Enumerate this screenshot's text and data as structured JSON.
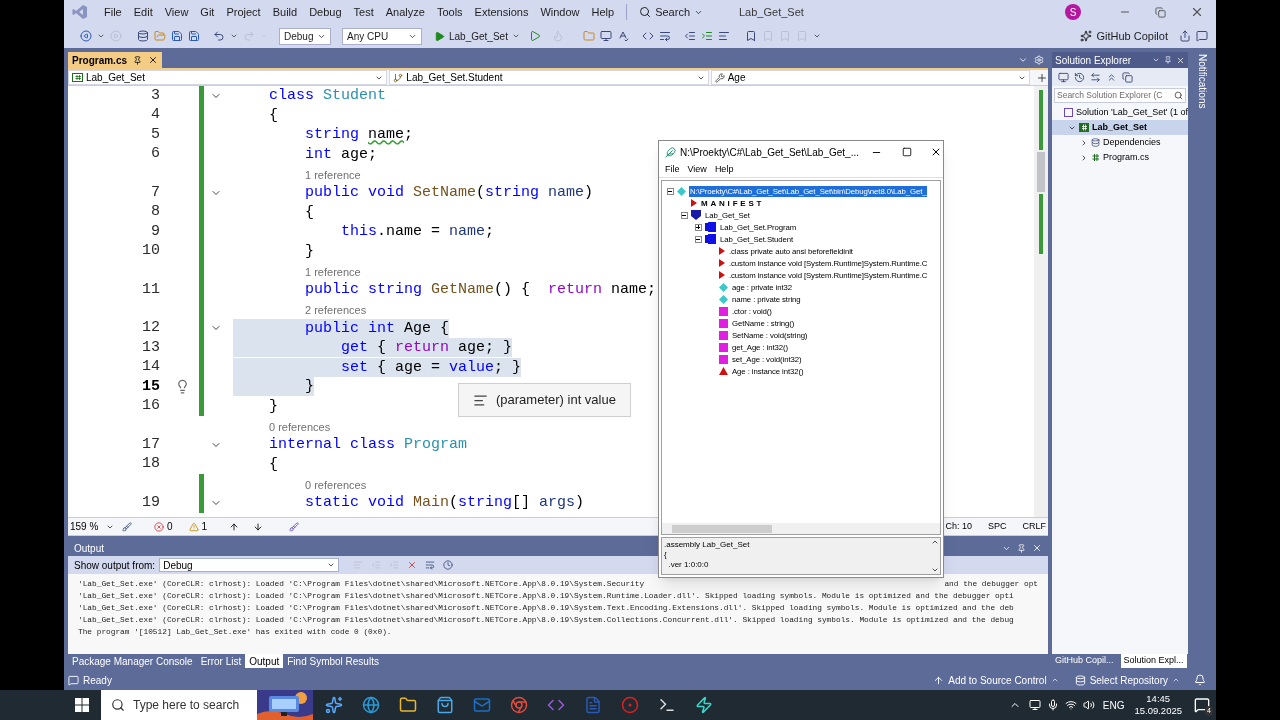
{
  "title_bar": {
    "menus": [
      "File",
      "Edit",
      "View",
      "Git",
      "Project",
      "Build",
      "Debug",
      "Test",
      "Analyze",
      "Tools",
      "Extensions",
      "Window",
      "Help"
    ],
    "search": "Search",
    "title": "Lab_Get_Set",
    "avatar": "S"
  },
  "toolbar": {
    "configuration": "Debug",
    "platform": "Any CPU",
    "start": "Lab_Get_Set",
    "copilot": "GitHub Copilot"
  },
  "editor": {
    "tabs": [
      {
        "label": "Program.cs",
        "selected": true
      }
    ],
    "navigation": [
      "Lab_Get_Set",
      "Lab_Get_Set.Student",
      "Age"
    ],
    "lines": [
      {
        "number": "3",
        "collapsible": true,
        "changed": true,
        "selected": false,
        "current": false,
        "tokens": [
          {
            "text": "    class ",
            "kind": "keyword"
          },
          {
            "text": "Student",
            "kind": "type"
          }
        ]
      },
      {
        "number": "4",
        "collapsible": false,
        "changed": true,
        "selected": false,
        "current": false,
        "tokens": [
          {
            "text": "    {",
            "kind": "plain"
          }
        ]
      },
      {
        "number": "5",
        "collapsible": false,
        "changed": true,
        "selected": false,
        "current": false,
        "tokens": [
          {
            "text": "        string ",
            "kind": "keyword"
          },
          {
            "text": "name",
            "kind": "plain",
            "squiggle": true
          },
          {
            "text": ";",
            "kind": "plain"
          }
        ]
      },
      {
        "number": "6",
        "collapsible": false,
        "changed": true,
        "selected": false,
        "current": false,
        "tokens": [
          {
            "text": "        int ",
            "kind": "keyword"
          },
          {
            "text": "age;",
            "kind": "plain"
          }
        ]
      },
      {
        "number": "7",
        "lens": "1 reference",
        "collapsible": true,
        "changed": true,
        "selected": false,
        "current": false,
        "tokens": [
          {
            "text": "        public void ",
            "kind": "keyword"
          },
          {
            "text": "SetName",
            "kind": "method"
          },
          {
            "text": "(",
            "kind": "plain"
          },
          {
            "text": "string ",
            "kind": "keyword"
          },
          {
            "text": "name",
            "kind": "param"
          },
          {
            "text": ")",
            "kind": "plain"
          }
        ]
      },
      {
        "number": "8",
        "collapsible": false,
        "changed": true,
        "selected": false,
        "current": false,
        "tokens": [
          {
            "text": "        {",
            "kind": "plain"
          }
        ]
      },
      {
        "number": "9",
        "collapsible": false,
        "changed": true,
        "selected": false,
        "current": false,
        "tokens": [
          {
            "text": "            this",
            "kind": "keyword"
          },
          {
            "text": ".name = ",
            "kind": "plain"
          },
          {
            "text": "name",
            "kind": "param"
          },
          {
            "text": ";",
            "kind": "plain"
          }
        ]
      },
      {
        "number": "10",
        "collapsible": false,
        "changed": true,
        "selected": false,
        "current": false,
        "tokens": [
          {
            "text": "        }",
            "kind": "plain"
          }
        ]
      },
      {
        "number": "11",
        "lens": "1 reference",
        "collapsible": false,
        "changed": true,
        "selected": false,
        "current": false,
        "tokens": [
          {
            "text": "        public string ",
            "kind": "keyword"
          },
          {
            "text": "GetName",
            "kind": "method"
          },
          {
            "text": "() {  ",
            "kind": "plain"
          },
          {
            "text": "return ",
            "kind": "control"
          },
          {
            "text": "name;",
            "kind": "plain"
          }
        ]
      },
      {
        "number": "12",
        "lens": "2 references",
        "collapsible": true,
        "changed": true,
        "selected": true,
        "current": false,
        "tokens": [
          {
            "text": "        public int ",
            "kind": "keyword"
          },
          {
            "text": "Age {",
            "kind": "plain"
          }
        ]
      },
      {
        "number": "13",
        "collapsible": false,
        "changed": true,
        "selected": true,
        "current": false,
        "tokens": [
          {
            "text": "            get ",
            "kind": "keyword"
          },
          {
            "text": "{ ",
            "kind": "plain"
          },
          {
            "text": "return ",
            "kind": "control"
          },
          {
            "text": "age; }",
            "kind": "plain"
          }
        ]
      },
      {
        "number": "14",
        "collapsible": false,
        "changed": true,
        "selected": true,
        "current": false,
        "tokens": [
          {
            "text": "            set ",
            "kind": "keyword"
          },
          {
            "text": "{ age = ",
            "kind": "plain"
          },
          {
            "text": "value",
            "kind": "keyword"
          },
          {
            "text": "; }",
            "kind": "plain"
          }
        ]
      },
      {
        "number": "15",
        "collapsible": false,
        "changed": true,
        "selected": true,
        "current": true,
        "lightbulb": true,
        "tokens": [
          {
            "text": "        }",
            "kind": "plain"
          }
        ]
      },
      {
        "number": "16",
        "collapsible": false,
        "changed": true,
        "selected": false,
        "current": false,
        "tokens": [
          {
            "text": "    }",
            "kind": "plain"
          }
        ]
      },
      {
        "number": "17",
        "lens": "0 references",
        "collapsible": true,
        "changed": false,
        "selected": false,
        "current": false,
        "tokens": [
          {
            "text": "    internal class ",
            "kind": "keyword"
          },
          {
            "text": "Program",
            "kind": "type"
          }
        ]
      },
      {
        "number": "18",
        "collapsible": false,
        "changed": false,
        "selected": false,
        "current": false,
        "tokens": [
          {
            "text": "    {",
            "kind": "plain"
          }
        ]
      },
      {
        "number": "19",
        "lens": "0 references",
        "collapsible": true,
        "changed": true,
        "selected": false,
        "current": false,
        "tokens": [
          {
            "text": "        static void ",
            "kind": "keyword"
          },
          {
            "text": "Main",
            "kind": "method"
          },
          {
            "text": "(",
            "kind": "plain"
          },
          {
            "text": "string",
            "kind": "keyword"
          },
          {
            "text": "[] ",
            "kind": "plain"
          },
          {
            "text": "args",
            "kind": "param"
          },
          {
            "text": ")",
            "kind": "plain"
          }
        ]
      }
    ],
    "tooltip": "(parameter) int value",
    "status": {
      "zoom": "159 %",
      "errors": "0",
      "warnings": "1",
      "column": "Ch: 10",
      "indent": "SPC",
      "line_ending": "CRLF"
    }
  },
  "ildasm": {
    "title": "N:\\Proekty\\C#\\Lab_Get_Set\\Lab_Get_...",
    "menus": [
      "File",
      "View",
      "Help"
    ],
    "tree": [
      {
        "label": "N:\\Proekty\\C#\\Lab_Get_Set\\Lab_Get_Set\\bin\\Debug\\net8.0\\Lab_Get_",
        "kind": "assembly",
        "selected": true,
        "expanded": true,
        "children": [
          {
            "label": "MANIFEST",
            "kind": "manifest",
            "selected": false
          },
          {
            "label": "Lab_Get_Set",
            "kind": "namespace",
            "selected": false,
            "expanded": true,
            "children": [
              {
                "label": "Lab_Get_Set.Program",
                "kind": "class",
                "selected": false,
                "expanded": false
              },
              {
                "label": "Lab_Get_Set.Student",
                "kind": "class",
                "selected": false,
                "expanded": true,
                "children": [
                  {
                    "label": ".class private auto ansi beforefieldinit",
                    "kind": "directive",
                    "selected": false
                  },
                  {
                    "label": ".custom instance void [System.Runtime]System.Runtime.C",
                    "kind": "directive",
                    "selected": false
                  },
                  {
                    "label": ".custom instance void [System.Runtime]System.Runtime.C",
                    "kind": "directive",
                    "selected": false
                  },
                  {
                    "label": "age : private int32",
                    "kind": "field",
                    "selected": false
                  },
                  {
                    "label": "name : private string",
                    "kind": "field",
                    "selected": false
                  },
                  {
                    "label": ".ctor : void()",
                    "kind": "method",
                    "selected": false
                  },
                  {
                    "label": "GetName : string()",
                    "kind": "method",
                    "selected": false
                  },
                  {
                    "label": "SetName : void(string)",
                    "kind": "method",
                    "selected": false
                  },
                  {
                    "label": "get_Age : int32()",
                    "kind": "method",
                    "selected": false
                  },
                  {
                    "label": "set_Age : void(int32)",
                    "kind": "method",
                    "selected": false
                  },
                  {
                    "label": "Age : instance int32()",
                    "kind": "property",
                    "selected": false
                  }
                ]
              }
            ]
          }
        ]
      }
    ],
    "detail": [
      ".assembly Lab_Get_Set",
      "{",
      "  .ver 1:0:0:0"
    ]
  },
  "output": {
    "title": "Output",
    "source_label": "Show output from:",
    "source": "Debug",
    "lines": [
      {
        "text": "'Lab_Get_Set.exe' (CoreCLR: clrhost): Loaded 'C:\\Program Files\\dotnet\\shared\\Microsoft.NETCore.App\\8.0.19\\System.Security",
        "tail": "and the debugger opt"
      },
      {
        "text": "'Lab_Get_Set.exe' (CoreCLR: clrhost): Loaded 'C:\\Program Files\\dotnet\\shared\\Microsoft.NETCore.App\\8.0.19\\System.Runtime.Loader.dll'. Skipped loading symbols. Module is optimized and the debugger opti"
      },
      {
        "text": "'Lab_Get_Set.exe' (CoreCLR: clrhost): Loaded 'C:\\Program Files\\dotnet\\shared\\Microsoft.NETCore.App\\8.0.19\\System.Text.Encoding.Extensions.dll'. Skipped loading symbols. Module is optimized and the deb"
      },
      {
        "text": "'Lab_Get_Set.exe' (CoreCLR: clrhost): Loaded 'C:\\Program Files\\dotnet\\shared\\Microsoft.NETCore.App\\8.0.19\\System.Collections.Concurrent.dll'. Skipped loading symbols. Module is optimized and the debug"
      },
      {
        "text": "The program '[10512] Lab_Get_Set.exe' has exited with code 0 (0x0)."
      }
    ],
    "tabs": [
      {
        "label": "Package Manager Console",
        "selected": false
      },
      {
        "label": "Error List",
        "selected": false
      },
      {
        "label": "Output",
        "selected": true
      },
      {
        "label": "Find Symbol Results",
        "selected": false
      }
    ]
  },
  "solution_explorer": {
    "title": "Solution Explorer",
    "search_placeholder": "Search Solution Explorer (C",
    "tree": [
      {
        "label": "Solution 'Lab_Get_Set' (1 of",
        "kind": "solution",
        "selected": false,
        "children": [
          {
            "label": "Lab_Get_Set",
            "kind": "project",
            "selected": true,
            "expanded": true,
            "children": [
              {
                "label": "Dependencies",
                "kind": "dependencies",
                "selected": false,
                "expanded": false
              },
              {
                "label": "Program.cs",
                "kind": "csfile",
                "selected": false,
                "expanded": false
              }
            ]
          }
        ]
      }
    ],
    "tabs": [
      {
        "label": "GitHub Copil...",
        "selected": false
      },
      {
        "label": "Solution Expl...",
        "selected": true
      }
    ]
  },
  "notifications_label": "Notifications",
  "status_bar": {
    "state": "Ready",
    "source_control": "Add to Source Control",
    "repository": "Select Repository"
  },
  "taskbar": {
    "search_placeholder": "Type here to search",
    "language": "ENG",
    "time": "14:45",
    "date": "15.09.2025",
    "notification_count": "4"
  }
}
